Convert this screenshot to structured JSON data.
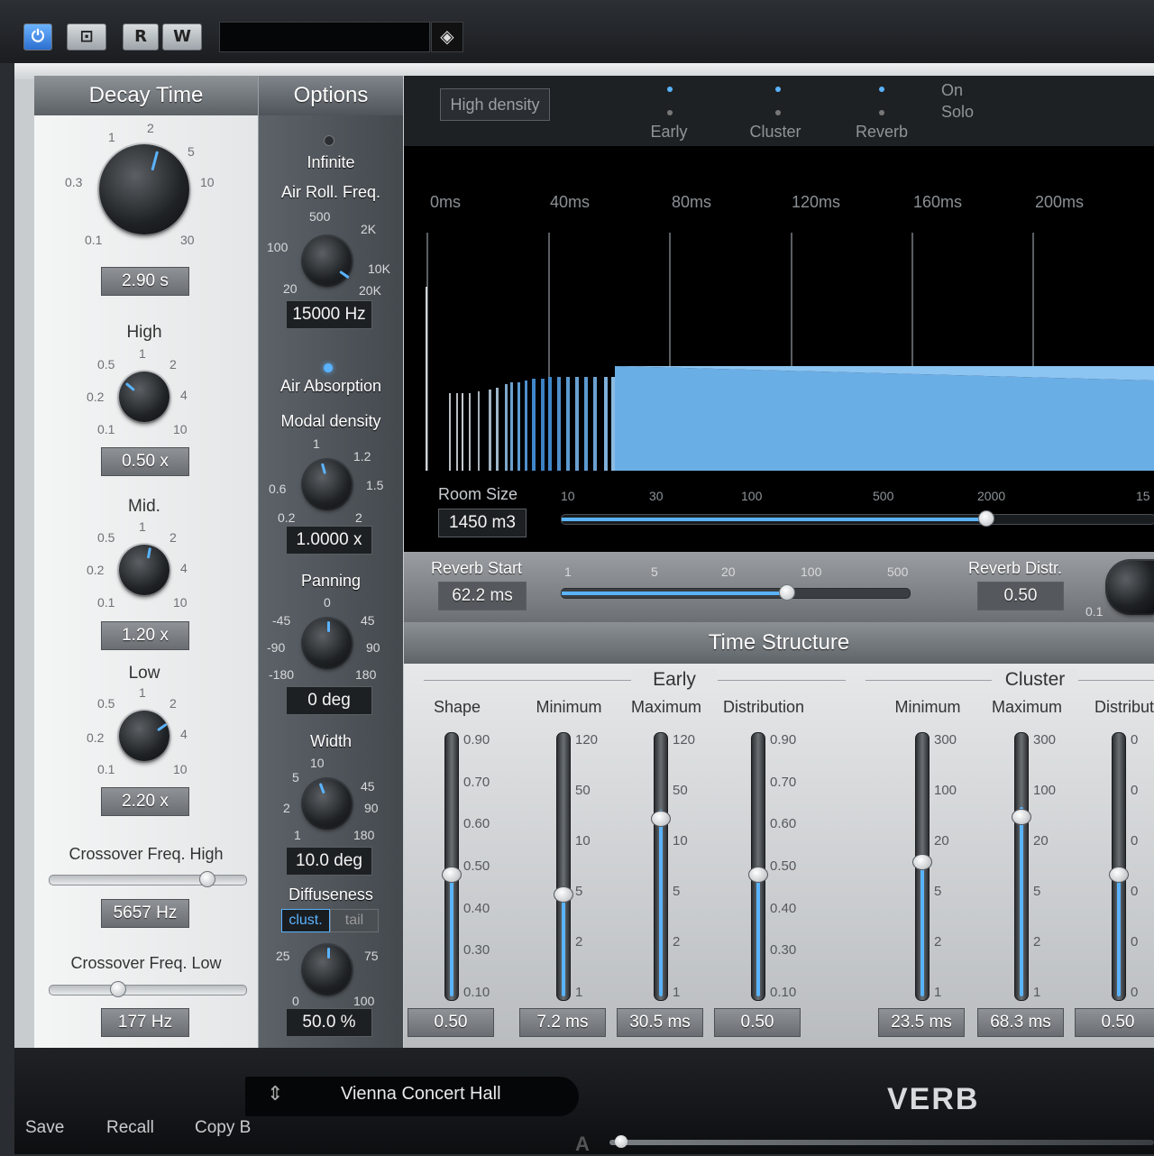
{
  "toolbar": {
    "power_icon": "power-icon",
    "bypass_icon": "bypass-icon",
    "read_label": "R",
    "write_label": "W",
    "preset_field": "",
    "diamond_icon": "diamond-icon"
  },
  "decay": {
    "header": "Decay Time",
    "decay_scale": [
      "0.1",
      "0.3",
      "1",
      "2",
      "5",
      "10",
      "30"
    ],
    "decay_value": "2.90 s",
    "high_label": "High",
    "high_value": "0.50 x",
    "mid_label": "Mid.",
    "mid_value": "1.20 x",
    "low_label": "Low",
    "low_value": "2.20 x",
    "band_scale": [
      "0.1",
      "0.2",
      "0.5",
      "1",
      "2",
      "4",
      "10"
    ],
    "xover_high_label": "Crossover Freq. High",
    "xover_high_value": "5657 Hz",
    "xover_high_level": 0.82,
    "xover_low_label": "Crossover Freq. Low",
    "xover_low_value": "177 Hz",
    "xover_low_level": 0.33
  },
  "options": {
    "header": "Options",
    "infinite_label": "Infinite",
    "air_roll_label": "Air Roll. Freq.",
    "air_roll_scale": [
      "20",
      "100",
      "500",
      "2K",
      "10K",
      "20K"
    ],
    "air_roll_value": "15000 Hz",
    "air_absorption_label": "Air Absorption",
    "modal_label": "Modal density",
    "modal_scale": [
      "0.2",
      "0.6",
      "1",
      "1.2",
      "1.5",
      "2"
    ],
    "modal_value": "1.0000 x",
    "panning_label": "Panning",
    "panning_scale": [
      "-180",
      "-90",
      "-45",
      "0",
      "45",
      "90",
      "180"
    ],
    "panning_value": "0 deg",
    "width_label": "Width",
    "width_scale": [
      "1",
      "2",
      "5",
      "10",
      "45",
      "90",
      "180"
    ],
    "width_value": "10.0 deg",
    "diffuseness_label": "Diffuseness",
    "diff_tab_cluster": "clust.",
    "diff_tab_tail": "tail",
    "diff_scale": [
      "0",
      "25",
      "75",
      "100"
    ],
    "diff_value": "50.0 %"
  },
  "graph": {
    "high_density_button": "High density",
    "tabs": [
      "Early",
      "Cluster",
      "Reverb"
    ],
    "on_label": "On",
    "solo_label": "Solo",
    "time_ticks": [
      "0ms",
      "40ms",
      "80ms",
      "120ms",
      "160ms",
      "200ms"
    ],
    "room_size_label": "Room Size",
    "room_size_value": "1450 m3",
    "room_scale": [
      "10",
      "30",
      "100",
      "500",
      "2000",
      "15"
    ],
    "room_size_level": 0.72,
    "reverb_start_label": "Reverb Start",
    "reverb_start_value": "62.2 ms",
    "reverb_start_scale": [
      "1",
      "5",
      "20",
      "100",
      "500"
    ],
    "reverb_start_level": 0.65,
    "reverb_distr_label": "Reverb Distr.",
    "reverb_distr_value": "0.50",
    "reverb_distr_scale": "0.1"
  },
  "time_structure": {
    "header": "Time Structure",
    "early_group": "Early",
    "cluster_group": "Cluster",
    "faders": [
      {
        "label": "Shape",
        "value": "0.50",
        "scale": [
          "0.90",
          "0.70",
          "0.60",
          "0.50",
          "0.40",
          "0.30",
          "0.10"
        ],
        "level": 0.5
      },
      {
        "label": "Minimum",
        "value": "7.2 ms",
        "scale": [
          "120",
          "50",
          "10",
          "5",
          "2",
          "1"
        ],
        "level": 0.42
      },
      {
        "label": "Maximum",
        "value": "30.5 ms",
        "scale": [
          "120",
          "50",
          "10",
          "5",
          "2",
          "1"
        ],
        "level": 0.72
      },
      {
        "label": "Distribution",
        "value": "0.50",
        "scale": [
          "0.90",
          "0.70",
          "0.60",
          "0.50",
          "0.40",
          "0.30",
          "0.10"
        ],
        "level": 0.5
      },
      {
        "label": "Minimum",
        "value": "23.5 ms",
        "scale": [
          "300",
          "100",
          "20",
          "5",
          "2",
          "1"
        ],
        "level": 0.55
      },
      {
        "label": "Maximum",
        "value": "68.3 ms",
        "scale": [
          "300",
          "100",
          "20",
          "5",
          "2",
          "1"
        ],
        "level": 0.73
      },
      {
        "label": "Distribut",
        "value": "0.50",
        "scale": [
          "0",
          "0",
          "0",
          "0",
          "0",
          "0"
        ],
        "level": 0.5
      }
    ]
  },
  "bottom": {
    "preset_arrows": "⇕",
    "preset_name": "Vienna Concert Hall",
    "logo": "VERB",
    "save_label": "Save",
    "recall_label": "Recall",
    "copy_label": "Copy B",
    "ab_label": "A"
  },
  "colors": {
    "accent": "#5ab3ff",
    "graph_fill": "#6aaee6"
  }
}
